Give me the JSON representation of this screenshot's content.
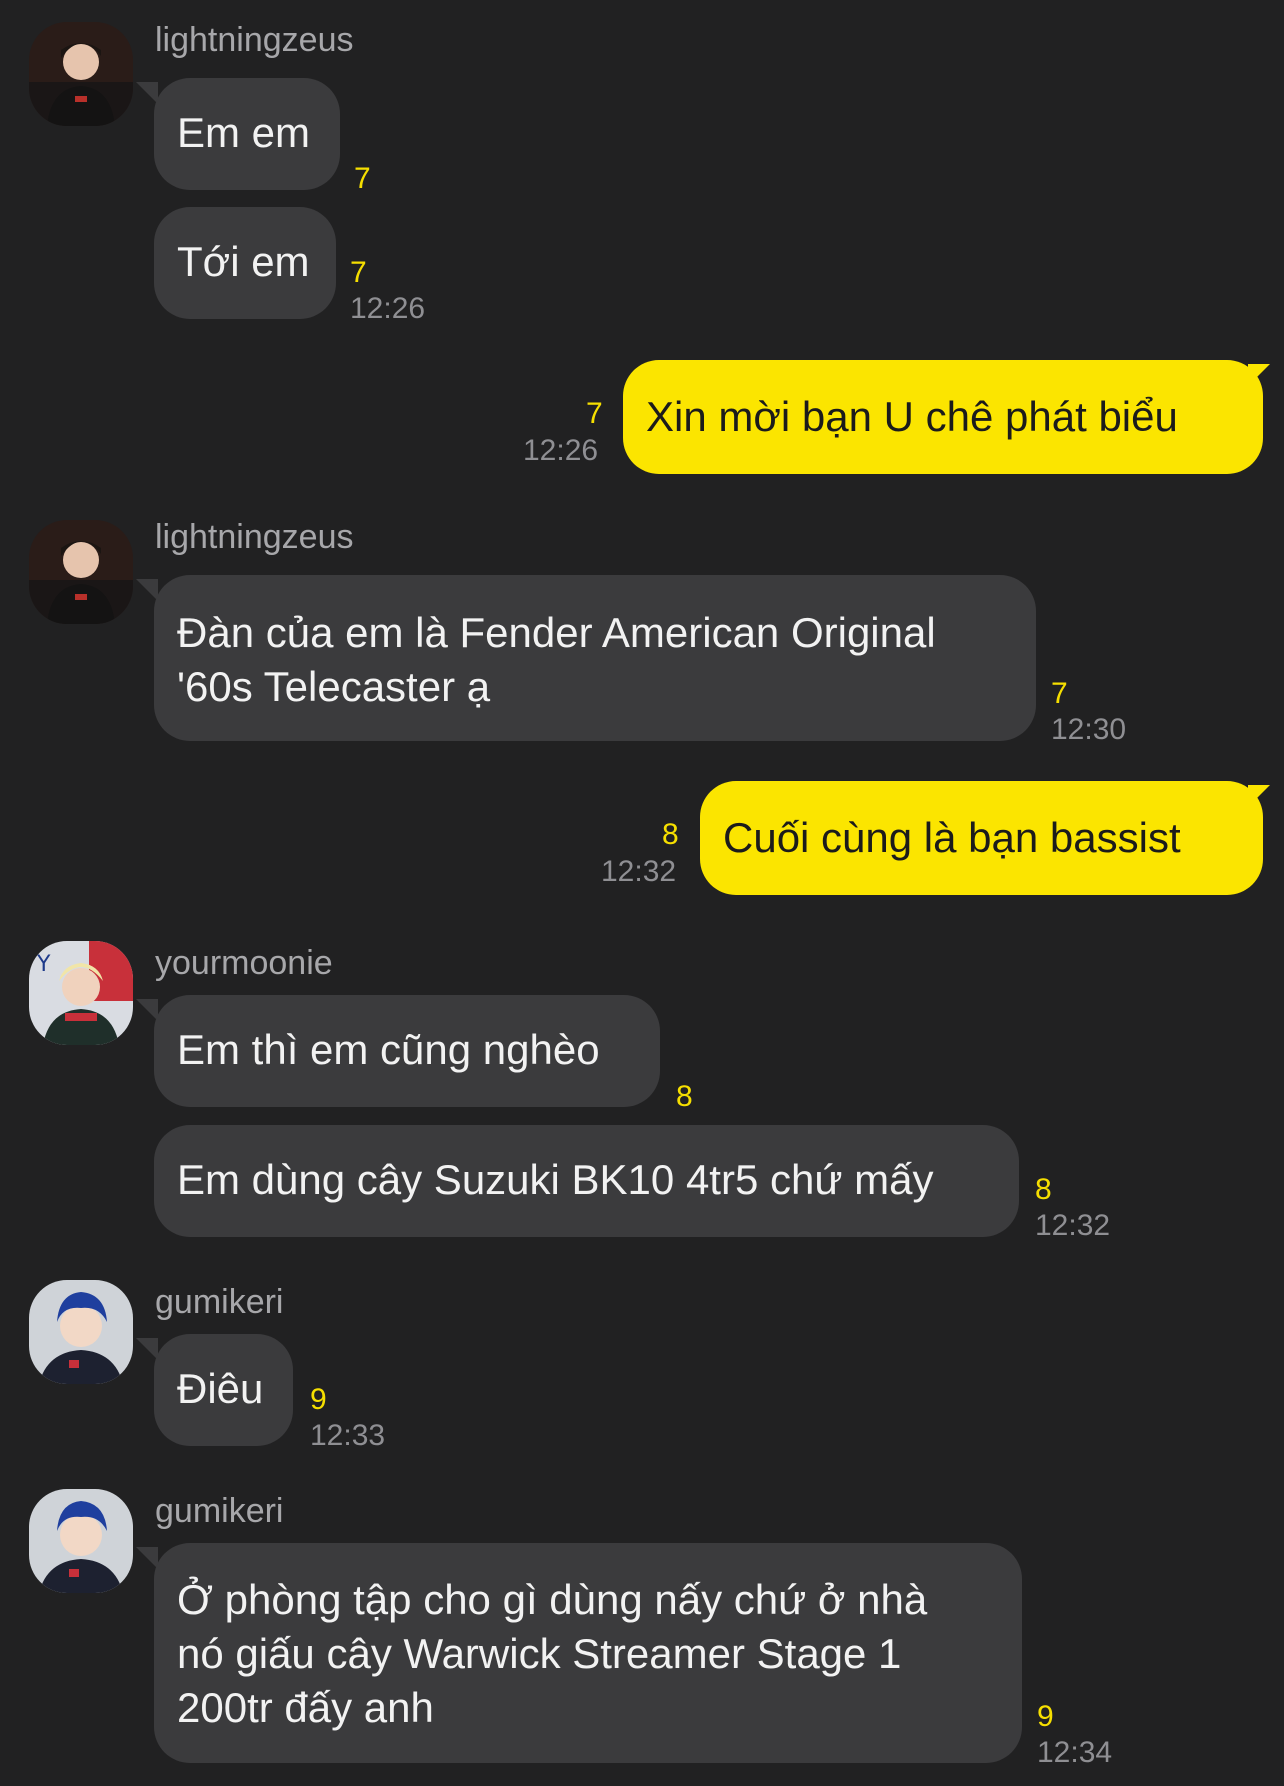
{
  "colors": {
    "background": "#212122",
    "incoming_bubble": "#3b3b3d",
    "outgoing_bubble": "#fbe500",
    "unread_count": "#f6df00",
    "timestamp": "#8f8f93"
  },
  "messages": [
    {
      "sender": "lightningzeus",
      "avatar": "avatar-lightningzeus",
      "bubbles": [
        {
          "text": "Em em",
          "unread": "7"
        },
        {
          "text": "Tới em",
          "unread": "7",
          "time": "12:26"
        }
      ]
    },
    {
      "sender": "me",
      "bubbles": [
        {
          "text": "Xin mời bạn U chê phát biểu",
          "unread": "7",
          "time": "12:26"
        }
      ]
    },
    {
      "sender": "lightningzeus",
      "avatar": "avatar-lightningzeus",
      "bubbles": [
        {
          "lines": [
            "Đàn của em là Fender American Original",
            "'60s Telecaster ạ"
          ],
          "unread": "7",
          "time": "12:30"
        }
      ]
    },
    {
      "sender": "me",
      "bubbles": [
        {
          "text": "Cuối cùng là bạn bassist",
          "unread": "8",
          "time": "12:32"
        }
      ]
    },
    {
      "sender": "yourmoonie",
      "avatar": "avatar-yourmoonie",
      "bubbles": [
        {
          "text": "Em thì em cũng nghèo",
          "unread": "8"
        },
        {
          "text": "Em dùng cây Suzuki BK10 4tr5 chứ mấy",
          "unread": "8",
          "time": "12:32"
        }
      ]
    },
    {
      "sender": "gumikeri",
      "avatar": "avatar-gumikeri",
      "bubbles": [
        {
          "text": "Điêu",
          "unread": "9",
          "time": "12:33"
        }
      ]
    },
    {
      "sender": "gumikeri",
      "avatar": "avatar-gumikeri",
      "bubbles": [
        {
          "lines": [
            "Ở phòng tập cho gì dùng nấy chứ ở nhà",
            "nó giấu cây Warwick Streamer Stage 1",
            "200tr đấy anh"
          ],
          "unread": "9",
          "time": "12:34"
        }
      ]
    }
  ]
}
